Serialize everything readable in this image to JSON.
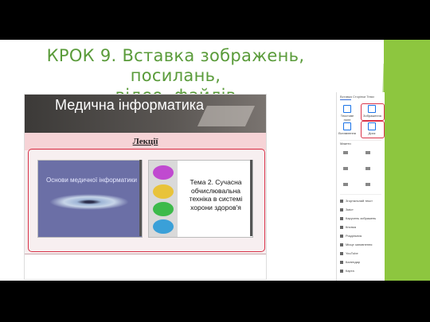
{
  "slide": {
    "title_line1": "КРОК 9. Вставка зображень, посилань,",
    "title_line2": "відео, файлів"
  },
  "site": {
    "banner_title": "Медична інформатика",
    "section_label": "Лекції",
    "presentation1_caption": "Основи медичної інформатики",
    "presentation2_text": "Тема 2. Сучасна обчислювальна техніка в системі хорони здоров'я"
  },
  "panel": {
    "tabs": "Вставка  Сторінки  Теми",
    "text_box_label": "Текстове поле",
    "images_label": "Зображення",
    "embed_label": "Вставлення",
    "drive_label": "Диск",
    "layouts_label": "Макети",
    "items": [
      "Згортальний текст",
      "Зміст",
      "Карусель зображень",
      "Кнопка",
      "Роздільник",
      "Місце заповнення",
      "YouTube",
      "Календар",
      "Карта"
    ]
  }
}
